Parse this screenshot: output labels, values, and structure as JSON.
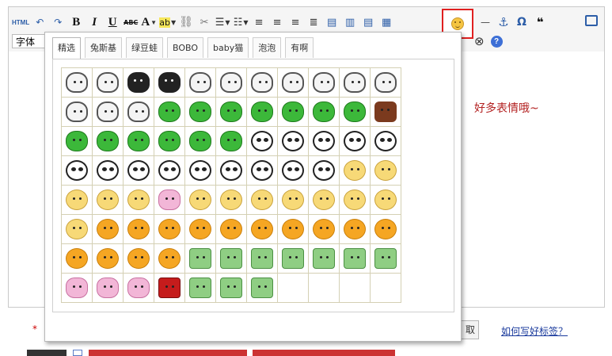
{
  "toolbar": {
    "html_label": "HTML",
    "bold_label": "B",
    "italic_label": "I",
    "underline_label": "U",
    "strike_label": "ABC",
    "font_color_label": "A",
    "highlight_label": "ab",
    "font_select_value": "字体",
    "symbol_label": "Ω",
    "quote_label": "❝"
  },
  "content": {
    "text": "好多表情哦~"
  },
  "emoticon_popup": {
    "tabs": [
      "精选",
      "兔斯基",
      "绿豆蛙",
      "BOBO",
      "baby猫",
      "泡泡",
      "有啊"
    ],
    "active_tab": "精选",
    "grid_rows": [
      [
        "rabbit",
        "rabbit",
        "dark",
        "dark",
        "rabbit",
        "rabbit",
        "rabbit",
        "rabbit",
        "rabbit",
        "rabbit",
        "rabbit"
      ],
      [
        "rabbit",
        "rabbit",
        "rabbit",
        "frog",
        "frog",
        "frog",
        "frog",
        "frog",
        "frog",
        "frog",
        "brown"
      ],
      [
        "frog",
        "frog",
        "frog",
        "frog",
        "frog",
        "frog",
        "panda",
        "panda",
        "panda",
        "panda",
        "panda"
      ],
      [
        "panda",
        "panda",
        "panda",
        "panda",
        "panda",
        "panda",
        "panda",
        "panda",
        "panda",
        "cat",
        "cat"
      ],
      [
        "cat",
        "cat",
        "cat",
        "pink",
        "cat",
        "cat",
        "cat",
        "cat",
        "cat",
        "cat",
        "cat"
      ],
      [
        "cat",
        "face",
        "face",
        "face",
        "face",
        "face",
        "face",
        "face",
        "face",
        "face",
        "face"
      ],
      [
        "face",
        "face",
        "face",
        "face",
        "boxg",
        "boxg",
        "boxg",
        "boxg",
        "boxg",
        "boxg",
        "boxg"
      ],
      [
        "pink",
        "pink",
        "pink",
        "red",
        "boxg",
        "boxg",
        "boxg",
        "",
        "",
        "",
        ""
      ]
    ]
  },
  "form": {
    "required_mark": "*",
    "side_button_label": "取",
    "help_link": "如何写好标签？"
  },
  "colors": {
    "highlight_border": "#e02020",
    "content_text": "#b32121",
    "link": "#1a3a9c"
  }
}
